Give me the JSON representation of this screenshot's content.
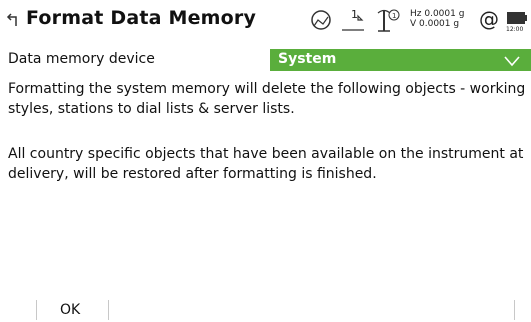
{
  "header": {
    "title": "Format Data Memory",
    "back_icon": "back-arrow-icon",
    "status": {
      "prism_number": "1",
      "tilt_number": "1",
      "hz": "Hz 0.0001 g",
      "v": "V  0.0001 g",
      "battery_time": "12:00"
    }
  },
  "field": {
    "label": "Data memory device",
    "value": "System"
  },
  "messages": {
    "line1": "Formatting the system memory will delete the following objects - working styles, stations to dial lists & server lists.",
    "line2": "All country specific objects that have been available on the instrument at delivery, will be restored after formatting is finished."
  },
  "softkeys": {
    "ok": "OK"
  },
  "colors": {
    "accent_green": "#5aae3c"
  }
}
